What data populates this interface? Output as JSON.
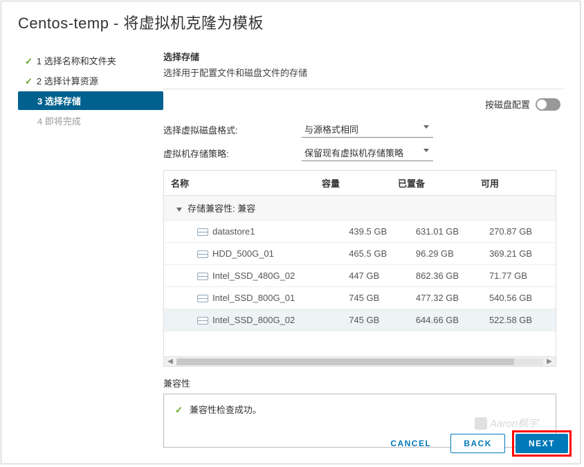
{
  "title": "Centos-temp - 将虚拟机克隆为模板",
  "sidebar": {
    "steps": [
      {
        "label": "1 选择名称和文件夹",
        "state": "done"
      },
      {
        "label": "2 选择计算资源",
        "state": "done"
      },
      {
        "label": "3 选择存储",
        "state": "active"
      },
      {
        "label": "4 即将完成",
        "state": "pending"
      }
    ]
  },
  "main": {
    "heading": "选择存储",
    "description": "选择用于配置文件和磁盘文件的存储",
    "toggle_label": "按磁盘配置",
    "toggle_on": false,
    "form": {
      "disk_format_label": "选择虚拟磁盘格式:",
      "disk_format_value": "与源格式相同",
      "storage_policy_label": "虚拟机存储策略:",
      "storage_policy_value": "保留现有虚拟机存储策略"
    },
    "columns": {
      "name": "名称",
      "capacity": "容量",
      "provisioned": "已置备",
      "free": "可用"
    },
    "group_label": "存储兼容性: 兼容",
    "datastores": [
      {
        "name": "datastore1",
        "capacity": "439.5 GB",
        "provisioned": "631.01 GB",
        "free": "270.87 GB",
        "selected": false
      },
      {
        "name": "HDD_500G_01",
        "capacity": "465.5 GB",
        "provisioned": "96.29 GB",
        "free": "369.21 GB",
        "selected": false
      },
      {
        "name": "Intel_SSD_480G_02",
        "capacity": "447 GB",
        "provisioned": "862.36 GB",
        "free": "71.77 GB",
        "selected": false
      },
      {
        "name": "Intel_SSD_800G_01",
        "capacity": "745 GB",
        "provisioned": "477.32 GB",
        "free": "540.56 GB",
        "selected": false
      },
      {
        "name": "Intel_SSD_800G_02",
        "capacity": "745 GB",
        "provisioned": "644.66 GB",
        "free": "522.58 GB",
        "selected": true
      }
    ],
    "compatibility_label": "兼容性",
    "compatibility_msg": "兼容性检查成功。"
  },
  "footer": {
    "cancel": "CANCEL",
    "back": "BACK",
    "next": "NEXT"
  },
  "watermark": "Aaron枫宇"
}
